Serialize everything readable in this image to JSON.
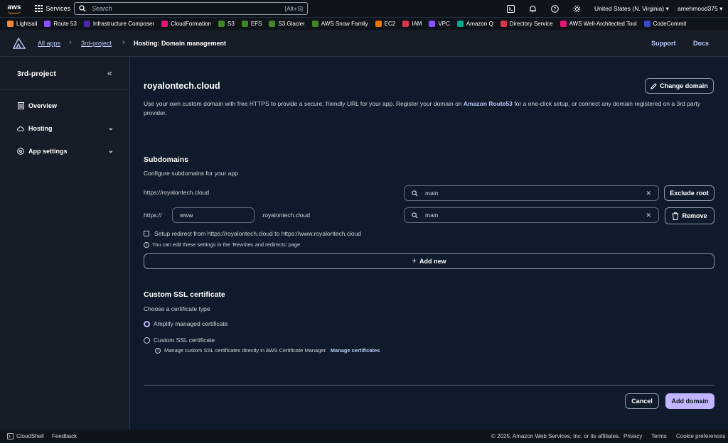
{
  "topnav": {
    "logo_text": "aws",
    "services_label": "Services",
    "search_placeholder": "Search",
    "search_shortcut": "[Alt+S]",
    "region": "United States (N. Virginia) ▾",
    "user": "amehmood375 ▾"
  },
  "bookmarks": [
    {
      "label": "Lightsail",
      "color": "#f58536"
    },
    {
      "label": "Route 53",
      "color": "#8c4fff"
    },
    {
      "label": "Infrastructure Composer",
      "color": "#4d27aa"
    },
    {
      "label": "CloudFormation",
      "color": "#e7157b"
    },
    {
      "label": "S3",
      "color": "#3f8624"
    },
    {
      "label": "EFS",
      "color": "#3f8624"
    },
    {
      "label": "S3 Glacier",
      "color": "#3f8624"
    },
    {
      "label": "AWS Snow Family",
      "color": "#3f8624"
    },
    {
      "label": "EC2",
      "color": "#ed7100"
    },
    {
      "label": "IAM",
      "color": "#dd344c"
    },
    {
      "label": "VPC",
      "color": "#8c4fff"
    },
    {
      "label": "Amazon Q",
      "color": "#01a88d"
    },
    {
      "label": "Directory Service",
      "color": "#dd344c"
    },
    {
      "label": "AWS Well-Architected Tool",
      "color": "#e7157b"
    },
    {
      "label": "CodeCommit",
      "color": "#3b48cc"
    }
  ],
  "breadcrumb": {
    "all_apps": "All apps",
    "project": "3rd-project",
    "current": "Hosting: Domain management"
  },
  "header_links": {
    "support": "Support",
    "docs": "Docs"
  },
  "sidebar": {
    "title": "3rd-project",
    "items": [
      {
        "label": "Overview"
      },
      {
        "label": "Hosting"
      },
      {
        "label": "App settings"
      }
    ]
  },
  "main": {
    "domain": "royalontech.cloud",
    "change_domain": "Change domain",
    "desc_before": "Use your own custom domain with free HTTPS to provide a secure, friendly URL for your app. Register your domain on ",
    "desc_link": "Amazon Route53",
    "desc_after": " for a one-click setup, or connect any domain registered on a 3rd party provider.",
    "subdomains_title": "Subdomains",
    "subdomains_sub": "Configure subdomains for your app",
    "root_url": "https://royalontech.cloud",
    "root_branch": "main",
    "exclude_root": "Exclude root",
    "prefix_scheme": "https://",
    "prefix_value": "www",
    "prefix_suffix": ".royalontech.cloud",
    "sub_branch": "main",
    "remove": "Remove",
    "redirect_label": "Setup redirect from https://royalontech.cloud to https://www.royalontech.cloud",
    "redirect_info": "You can edit these settings in the 'Rewrites and redirects' page",
    "add_new": "Add new",
    "ssl_title": "Custom SSL certificate",
    "ssl_sub": "Choose a certificate type",
    "ssl_option_managed": "Amplify managed certificate",
    "ssl_option_custom": "Custom SSL certificate",
    "ssl_info_text": "Manage custom SSL certificates directly in AWS Certificate Manager.",
    "ssl_info_link": "Manage certificates",
    "cancel": "Cancel",
    "add_domain": "Add domain"
  },
  "footer": {
    "cloudshell": "CloudShell",
    "feedback": "Feedback",
    "copyright": "© 2025, Amazon Web Services, Inc. or its affiliates.",
    "privacy": "Privacy",
    "terms": "Terms",
    "cookies": "Cookie preferences"
  },
  "colors": {
    "accent": "#c2b5ff",
    "link": "#b9c8f7",
    "background": "#0f1b2a",
    "panel": "#161d26"
  }
}
